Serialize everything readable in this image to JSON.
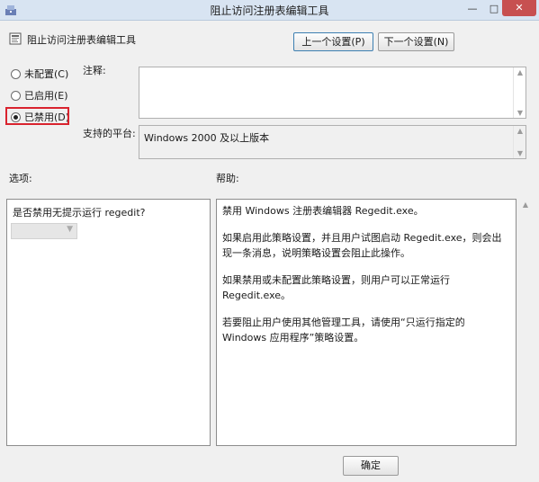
{
  "window": {
    "title": "阻止访问注册表编辑工具"
  },
  "header": {
    "policy_name": "阻止访问注册表编辑工具",
    "prev_button": "上一个设置(P)",
    "next_button": "下一个设置(N)"
  },
  "state": {
    "not_configured": "未配置(C)",
    "enabled": "已启用(E)",
    "disabled": "已禁用(D)",
    "selected": "disabled"
  },
  "comment": {
    "label": "注释:",
    "value": ""
  },
  "platform": {
    "label": "支持的平台:",
    "value": "Windows 2000 及以上版本"
  },
  "options": {
    "label": "选项:",
    "prompt": "是否禁用无提示运行 regedit?",
    "select_value": ""
  },
  "help": {
    "label": "帮助:",
    "paragraphs": [
      "禁用 Windows 注册表编辑器 Regedit.exe。",
      "如果启用此策略设置，并且用户试图启动 Regedit.exe，则会出现一条消息，说明策略设置会阻止此操作。",
      "如果禁用或未配置此策略设置，则用户可以正常运行 Regedit.exe。",
      "若要阻止用户使用其他管理工具，请使用“只运行指定的 Windows 应用程序”策略设置。"
    ]
  },
  "footer": {
    "ok_button": "确定"
  },
  "colors": {
    "highlight": "#d9232e",
    "close_button": "#c75050",
    "titlebar": "#d8e4f2"
  }
}
